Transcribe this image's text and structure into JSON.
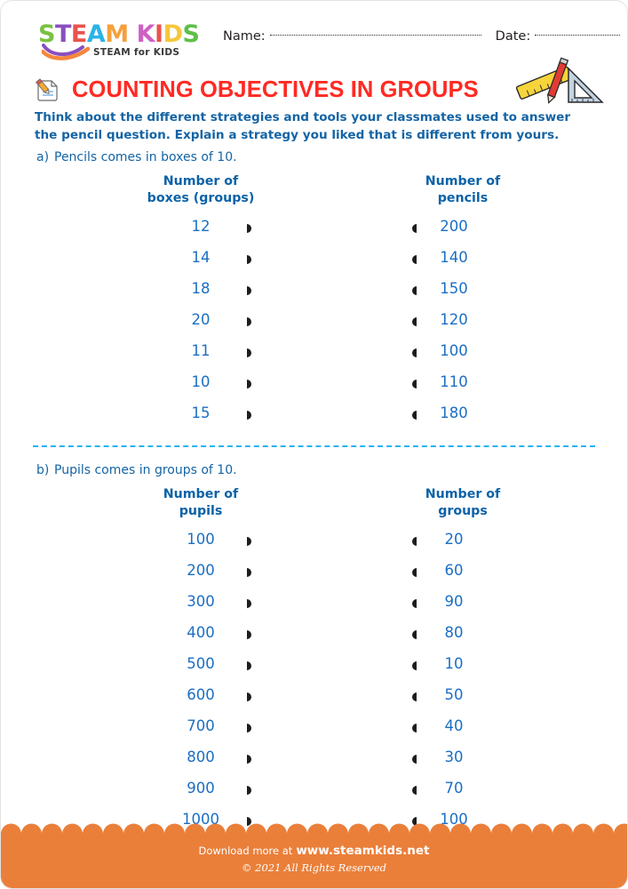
{
  "brand": {
    "logo_letters": [
      {
        "char": "S",
        "color": "#7ac143"
      },
      {
        "char": "T",
        "color": "#8a4fbf"
      },
      {
        "char": "E",
        "color": "#e8534e"
      },
      {
        "char": "A",
        "color": "#2bb3e6"
      },
      {
        "char": "M",
        "color": "#f5a03c"
      },
      {
        "char": "K",
        "color": "#cf5fc4"
      },
      {
        "char": "I",
        "color": "#e8534e"
      },
      {
        "char": "D",
        "color": "#f5c73c"
      },
      {
        "char": "S",
        "color": "#5fbf4a"
      }
    ],
    "tagline": "STEAM for KIDS",
    "swoosh_colors": [
      "#8a4fbf",
      "#f5873c"
    ]
  },
  "header": {
    "name_label": "Name:",
    "date_label": "Date:"
  },
  "title": {
    "text": "COUNTING OBJECTIVES IN GROUPS",
    "color": "#ff2a23",
    "icon": "note-pencil-icon"
  },
  "decor": {
    "tools_icon": "ruler-pencil-triangle-icon"
  },
  "intro": {
    "line1": "Think about the different strategies and tools your classmates used  to answer",
    "line2": "the pencil question. Explain a strategy you liked that is different from yours."
  },
  "colors": {
    "heading_blue": "#0b62a8",
    "value_blue": "#1b6fc4",
    "intro_blue": "#1464a5",
    "divider_blue": "#25b4f0",
    "footer_orange": "#ea7f3a",
    "title_red": "#ff2a23"
  },
  "sections": [
    {
      "marker": "a)",
      "prompt": "Pencils comes in boxes of 10.",
      "left_header_line1": "Number of",
      "left_header_line2": "boxes (groups)",
      "right_header_line1": "Number of",
      "right_header_line2": "pencils",
      "rows": [
        {
          "left": "12",
          "right": "200"
        },
        {
          "left": "14",
          "right": "140"
        },
        {
          "left": "18",
          "right": "150"
        },
        {
          "left": "20",
          "right": "120"
        },
        {
          "left": "11",
          "right": "100"
        },
        {
          "left": "10",
          "right": "110"
        },
        {
          "left": "15",
          "right": "180"
        }
      ]
    },
    {
      "marker": "b)",
      "prompt": "Pupils comes in groups of 10.",
      "left_header_line1": "Number of",
      "left_header_line2": "pupils",
      "right_header_line1": "Number of",
      "right_header_line2": "groups",
      "rows": [
        {
          "left": "100",
          "right": "20"
        },
        {
          "left": "200",
          "right": "60"
        },
        {
          "left": "300",
          "right": "90"
        },
        {
          "left": "400",
          "right": "80"
        },
        {
          "left": "500",
          "right": "10"
        },
        {
          "left": "600",
          "right": "50"
        },
        {
          "left": "700",
          "right": "40"
        },
        {
          "left": "800",
          "right": "30"
        },
        {
          "left": "900",
          "right": "70"
        },
        {
          "left": "1000",
          "right": "100"
        }
      ]
    }
  ],
  "footer": {
    "download_text": "Download more at",
    "site": "www.steamkids.net",
    "copyright": "© 2021 All Rights Reserved"
  }
}
